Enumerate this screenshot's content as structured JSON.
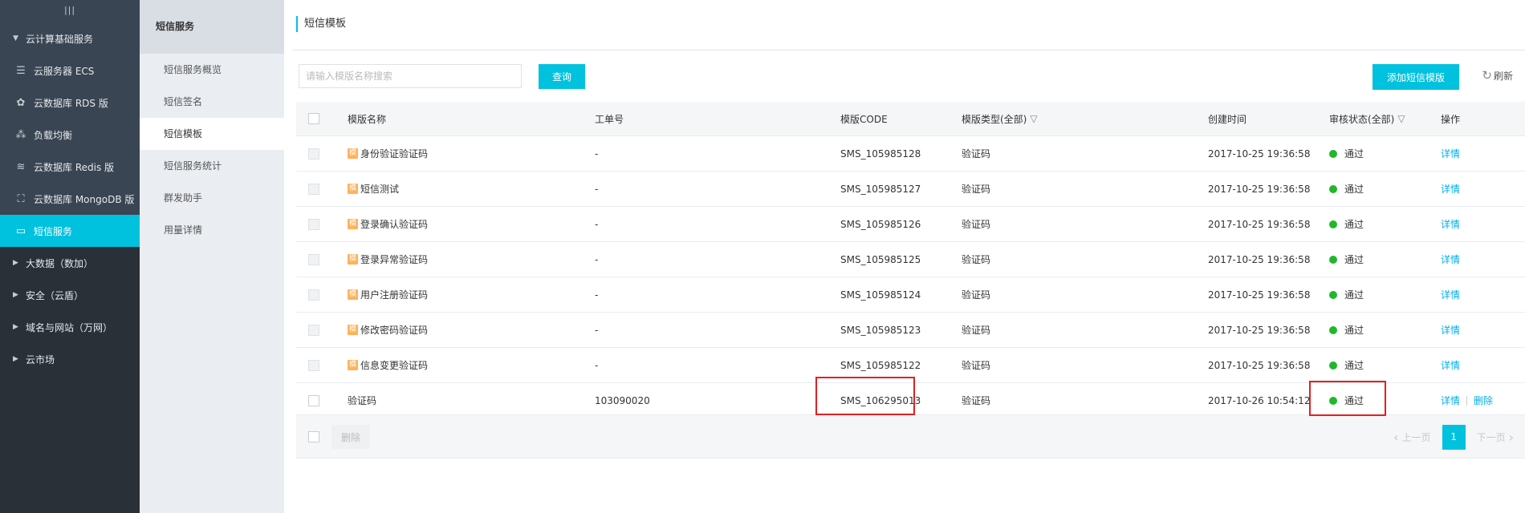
{
  "sidebar": {
    "toggle_icon": "menu-toggle-icon",
    "sections": [
      {
        "label": "云计算基础服务",
        "open": true,
        "items": [
          {
            "label": "云服务器 ECS",
            "icon": "server-icon"
          },
          {
            "label": "云数据库 RDS 版",
            "icon": "database-icon"
          },
          {
            "label": "负载均衡",
            "icon": "load-balance-icon"
          },
          {
            "label": "云数据库 Redis 版",
            "icon": "redis-icon"
          },
          {
            "label": "云数据库 MongoDB 版",
            "icon": "mongodb-icon"
          },
          {
            "label": "短信服务",
            "icon": "sms-icon",
            "active": true
          }
        ]
      },
      {
        "label": "大数据（数加）"
      },
      {
        "label": "安全（云盾）"
      },
      {
        "label": "域名与网站（万网）"
      },
      {
        "label": "云市场"
      }
    ]
  },
  "subnav": {
    "title": "短信服务",
    "items": [
      "短信服务概览",
      "短信签名",
      "短信模板",
      "短信服务统计",
      "群发助手",
      "用量详情"
    ],
    "active_index": 2
  },
  "main": {
    "title": "短信模板",
    "search": {
      "placeholder": "请输入模版名称搜索",
      "value": ""
    },
    "search_button": "查询",
    "add_button": "添加短信模版",
    "refresh": "刷新",
    "columns": [
      "模版名称",
      "工单号",
      "模版CODE",
      "模版类型(全部)",
      "创建时间",
      "审核状态(全部)",
      "操作"
    ],
    "rows": [
      {
        "name": "身份验证验证码",
        "order": "-",
        "code": "SMS_105985128",
        "type": "验证码",
        "time": "2017-10-25 19:36:58",
        "status": "通过",
        "ops": [
          "详情"
        ]
      },
      {
        "name": "短信测试",
        "order": "-",
        "code": "SMS_105985127",
        "type": "验证码",
        "time": "2017-10-25 19:36:58",
        "status": "通过",
        "ops": [
          "详情"
        ]
      },
      {
        "name": "登录确认验证码",
        "order": "-",
        "code": "SMS_105985126",
        "type": "验证码",
        "time": "2017-10-25 19:36:58",
        "status": "通过",
        "ops": [
          "详情"
        ]
      },
      {
        "name": "登录异常验证码",
        "order": "-",
        "code": "SMS_105985125",
        "type": "验证码",
        "time": "2017-10-25 19:36:58",
        "status": "通过",
        "ops": [
          "详情"
        ]
      },
      {
        "name": "用户注册验证码",
        "order": "-",
        "code": "SMS_105985124",
        "type": "验证码",
        "time": "2017-10-25 19:36:58",
        "status": "通过",
        "ops": [
          "详情"
        ]
      },
      {
        "name": "修改密码验证码",
        "order": "-",
        "code": "SMS_105985123",
        "type": "验证码",
        "time": "2017-10-25 19:36:58",
        "status": "通过",
        "ops": [
          "详情"
        ]
      },
      {
        "name": "信息变更验证码",
        "order": "-",
        "code": "SMS_105985122",
        "type": "验证码",
        "time": "2017-10-25 19:36:58",
        "status": "通过",
        "ops": [
          "详情"
        ]
      },
      {
        "name": "验证码",
        "order": "103090020",
        "code": "SMS_106295013",
        "type": "验证码",
        "time": "2017-10-26 10:54:12",
        "status": "通过",
        "ops": [
          "详情",
          "删除"
        ],
        "custom": true
      }
    ],
    "template_badge": "模",
    "footer": {
      "delete_button": "删除",
      "prev": "上一页",
      "next": "下一页",
      "current_page": "1"
    }
  },
  "colors": {
    "accent": "#00c1de",
    "sidebar_bg": "#293038",
    "status_ok": "#1fb82a",
    "highlight": "#e02020",
    "link": "#00aee8"
  }
}
